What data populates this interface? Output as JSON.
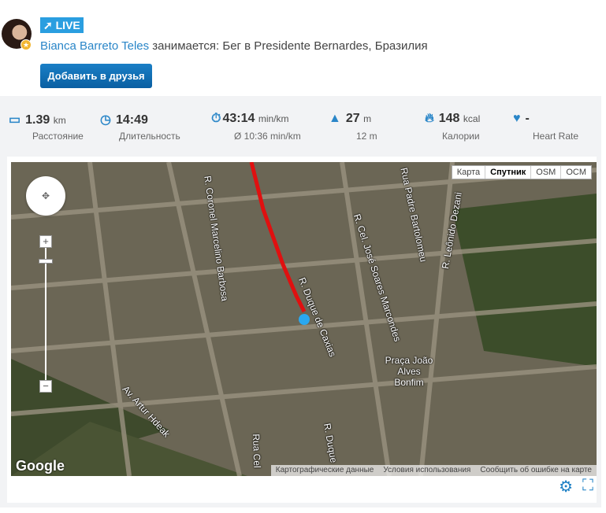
{
  "header": {
    "live_badge": "LIVE",
    "user_name": "Bianca Barreto Teles",
    "activity_text": " занимается: Бег в Presidente Bernardes, Бразилия",
    "add_friend_label": "Добавить в друзья"
  },
  "stats": [
    {
      "icon": "ruler-icon",
      "value": "1.39",
      "unit": "km",
      "label": "Расстояние"
    },
    {
      "icon": "clock-icon",
      "value": "14:49",
      "unit": "",
      "label": "Длительность"
    },
    {
      "icon": "pace-icon",
      "value": "43:14",
      "unit": "min/km",
      "label": "Ø 10:36 min/km"
    },
    {
      "icon": "elevation-icon",
      "value": "27",
      "unit": "m",
      "label": "12 m"
    },
    {
      "icon": "flame-icon",
      "value": "148",
      "unit": "kcal",
      "label": "Калории"
    },
    {
      "icon": "heart-rate-icon",
      "value": "-",
      "unit": "",
      "label": "Heart Rate"
    }
  ],
  "map": {
    "types": [
      "Карта",
      "Спутник",
      "OSM",
      "OCM"
    ],
    "streets": [
      "R. Duque de Caxias",
      "Praça João Alves Bonfim",
      "R. Cel. José Soares Marcondes",
      "R. Coronel Marcelino Barbosa",
      "Av. Artur Hdeak",
      "Rua Padre Bartolomeu",
      "R. Leônido Dezani",
      "R. Duque",
      "Rua Cel"
    ],
    "attribution": [
      "Картографические данные",
      "Условия использования",
      "Сообщить об ошибке на карте"
    ],
    "logo": "Google",
    "route_color": "#e01010"
  }
}
